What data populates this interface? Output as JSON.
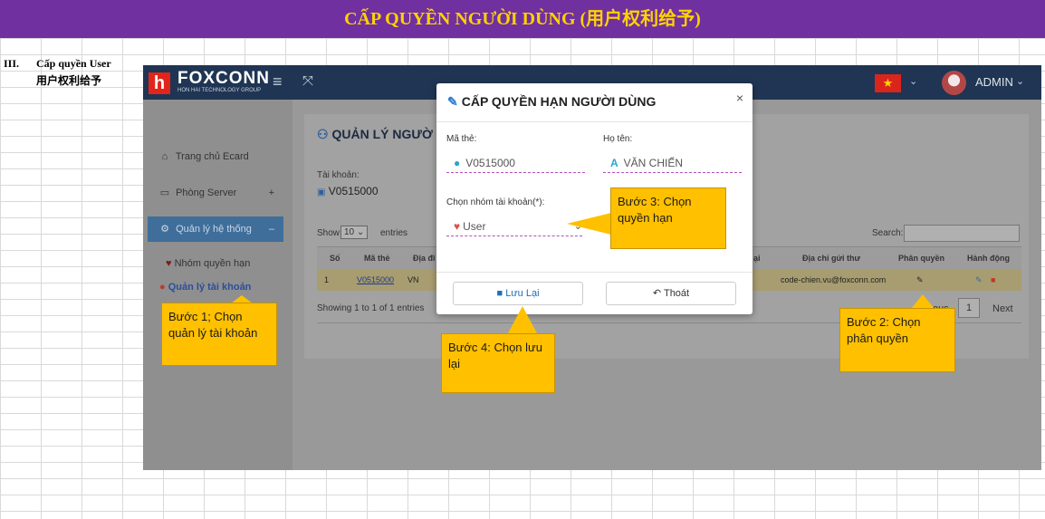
{
  "banner": {
    "title": "CẤP QUYỀN NGƯỜI DÙNG (用户权利给予)"
  },
  "section": {
    "number": "III.",
    "title": "Cấp quyền User",
    "subtitle": "用户权利给予"
  },
  "app": {
    "logo_text": "FOXCONN",
    "logo_sub": "HON HAI TECHNOLOGY GROUP",
    "user_name": "ADMIN",
    "colors": {
      "topbar": "#1f3553",
      "accent": "#3f6e9a",
      "callout": "#ffc000",
      "banner": "#7030a0",
      "banner_text": "#ffd200"
    }
  },
  "sidebar": {
    "items": [
      {
        "label": "Trang chủ Ecard",
        "icon": "home-icon"
      },
      {
        "label": "Phòng Server",
        "icon": "server-icon",
        "toggle": "+"
      },
      {
        "label": "Quản lý hệ thống",
        "icon": "gear-icon",
        "toggle": "–"
      }
    ],
    "subitems": [
      {
        "label": "Nhóm quyền hạn",
        "icon": "shield-icon"
      },
      {
        "label": "Quản lý tài khoản",
        "icon": "users-icon"
      }
    ]
  },
  "panel": {
    "title": "QUẢN LÝ NGƯỜ",
    "account_label": "Tài khoản:",
    "account_value": "V0515000",
    "show_label": "Show",
    "show_value": "10",
    "entries_label": "entries",
    "search_label": "Search:",
    "columns": [
      "Số",
      "Mã thẻ",
      "Địa đi",
      "ại",
      "Địa chỉ gửi thư",
      "Phân quyền",
      "Hành động"
    ],
    "row": {
      "no": "1",
      "card": "V0515000",
      "loc": "VN",
      "email": "code-chien.vu@foxconn.com"
    },
    "showing": "Showing 1 to 1 of 1 entries",
    "page": "1",
    "next": "Next",
    "prev_fragment": "ous"
  },
  "modal": {
    "title": "CẤP QUYỀN HẠN NGƯỜI DÙNG",
    "close": "×",
    "card_label": "Mã thẻ:",
    "card_value": "V0515000",
    "name_label": "Họ tên:",
    "name_value": "VĂN CHIẾN",
    "group_label": "Chọn nhóm tài khoản(*):",
    "group_value": "User",
    "save": "Lưu Lại",
    "exit": "Thoát"
  },
  "callouts": {
    "step1": "Bước 1; Chọn quản lý tài khoản",
    "step2": "Bước 2: Chọn phân quyền",
    "step3": "Bước 3: Chọn quyền hạn",
    "step4": "Bước 4: Chọn lưu lại"
  }
}
